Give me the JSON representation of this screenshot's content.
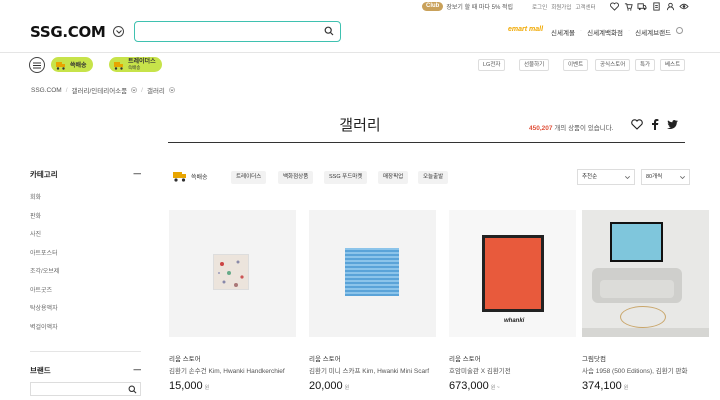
{
  "utility": {
    "club_badge": "Club",
    "club_text": "장보기 할 때 마다 5% 적립",
    "links": [
      "로그인",
      "회원가입",
      "고객센터"
    ]
  },
  "header": {
    "logo": "SSG.COM",
    "search_placeholder": "",
    "emart_label": "emart mall",
    "brands": [
      "신세계몰",
      "신세계백화점",
      "신세계브랜드"
    ]
  },
  "subnav": {
    "pills": [
      {
        "label": "쓱배송"
      },
      {
        "label": "트레이더스",
        "sub": "쓱배송"
      }
    ],
    "quick_links": [
      "LG전자",
      "선물하기",
      "이벤트",
      "공식스토어",
      "특가",
      "베스트"
    ]
  },
  "breadcrumb": [
    "SSG.COM",
    "갤러리/인테리어소품",
    "갤러리"
  ],
  "page": {
    "title": "갤러리",
    "count_number": "450,207",
    "count_suffix": "개의 상품이 있습니다."
  },
  "sidebar": {
    "category_title": "카테고리",
    "categories": [
      "회화",
      "판화",
      "사진",
      "아트포스터",
      "조각/오브제",
      "아트굿즈",
      "탁상용액자",
      "벽걸이액자"
    ],
    "brand_title": "브랜드"
  },
  "filters": {
    "ship_label": "쓱배송",
    "tags": [
      "트레이더스",
      "백화점상품",
      "SSG 푸드마켓",
      "매장픽업",
      "오늘출발"
    ],
    "sort_value": "추천순",
    "page_size_value": "80개씩"
  },
  "products": [
    {
      "store": "리움 스토어",
      "name": "김환기 손수건 Kim, Hwanki Handkerchief",
      "price": "15,000",
      "unit": "원"
    },
    {
      "store": "리움 스토어",
      "name": "김환기 미니 스카프 Kim, Hwanki Mini Scarf",
      "price": "20,000",
      "unit": "원"
    },
    {
      "store": "리움 스토어",
      "name": "호암미술관 X 김환기전",
      "price": "673,000",
      "unit": "원 ~"
    },
    {
      "store": "그림닷컴",
      "name": "사슴 1958 (500 Editions), 김환기 판화",
      "price": "374,100",
      "unit": "원"
    }
  ],
  "colors": {
    "accent_teal": "#3fc1b0",
    "ship_green": "#c7e34a",
    "count_red": "#e0513a",
    "club_gold": "#c9a15a"
  }
}
